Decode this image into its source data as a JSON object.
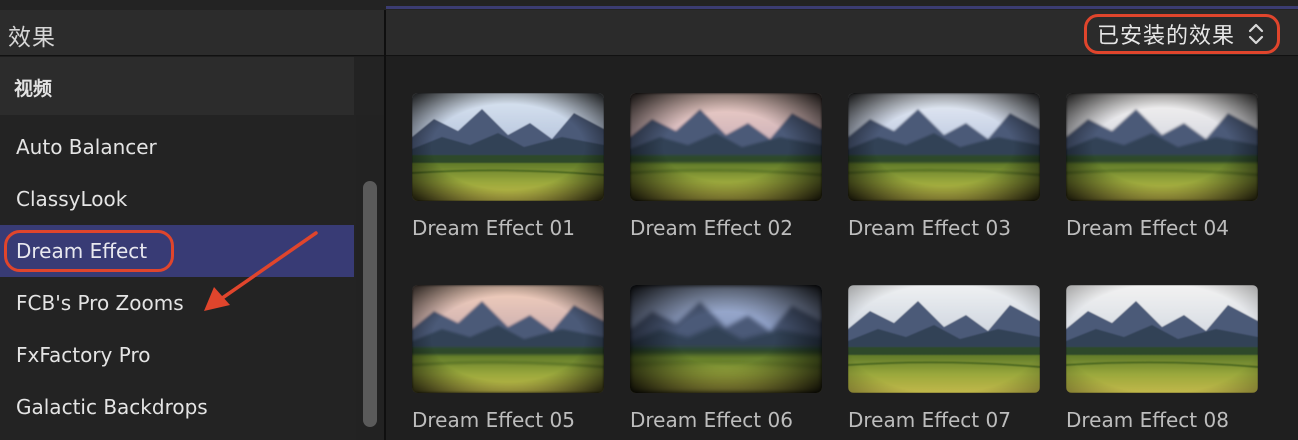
{
  "header": {
    "title": "效果",
    "filter_label": "已安装的效果"
  },
  "sidebar": {
    "section": "视频",
    "items": [
      {
        "label": "Auto Balancer"
      },
      {
        "label": "ClassyLook"
      },
      {
        "label": "Dream Effect"
      },
      {
        "label": "FCB's Pro Zooms"
      },
      {
        "label": "FxFactory Pro"
      },
      {
        "label": "Galactic Backdrops"
      }
    ]
  },
  "effects": [
    {
      "label": "Dream Effect 01"
    },
    {
      "label": "Dream Effect 02"
    },
    {
      "label": "Dream Effect 03"
    },
    {
      "label": "Dream Effect 04"
    },
    {
      "label": "Dream Effect 05"
    },
    {
      "label": "Dream Effect 06"
    },
    {
      "label": "Dream Effect 07"
    },
    {
      "label": "Dream Effect 08"
    }
  ],
  "colors": {
    "selection": "#383b75",
    "annotation": "#e0452c"
  }
}
